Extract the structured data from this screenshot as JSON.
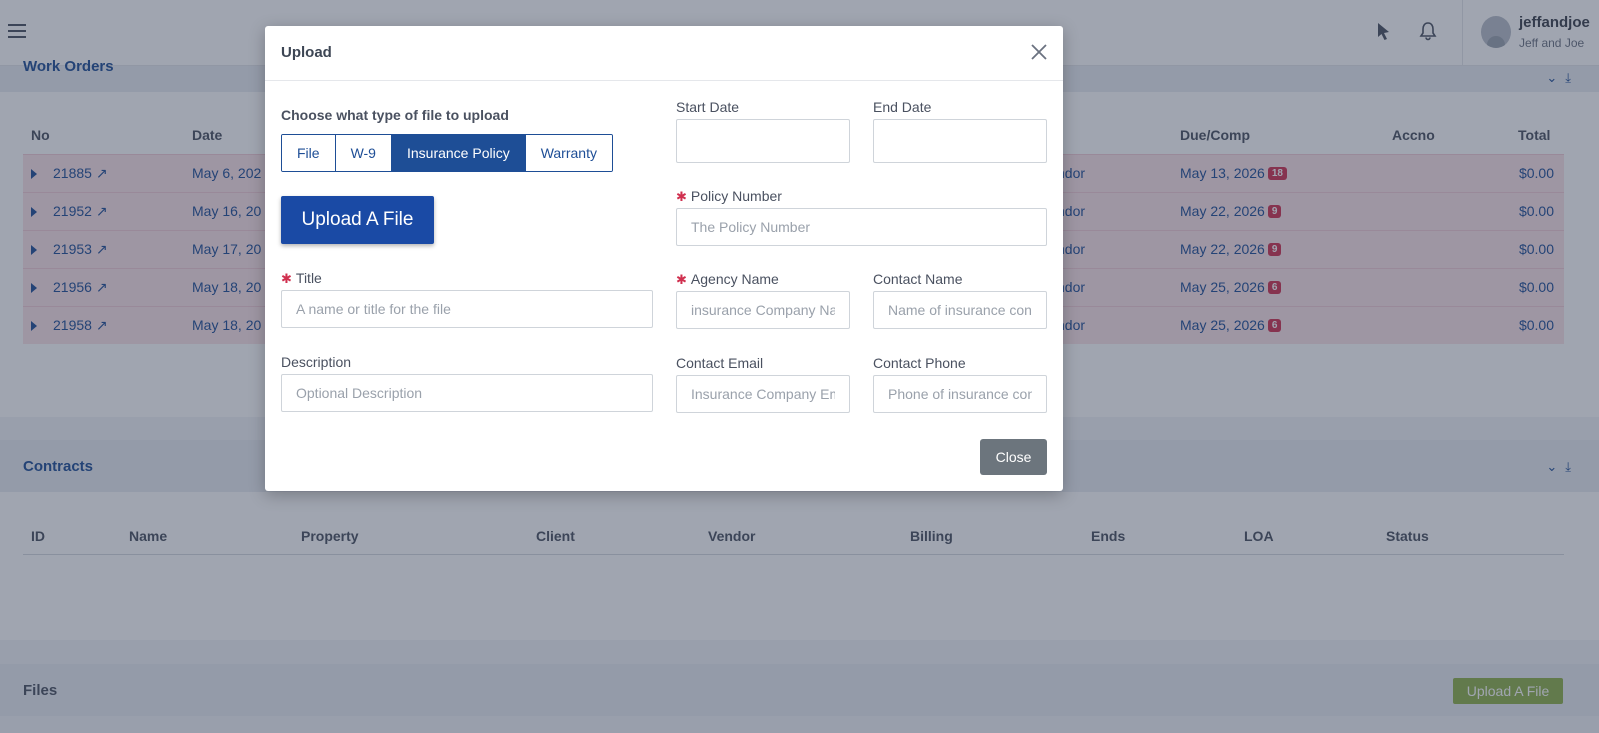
{
  "topbar": {
    "username": "jeffandjoe",
    "company": "Jeff and Joe"
  },
  "work_orders": {
    "title": "Work Orders",
    "columns": [
      "No",
      "Date",
      "Due/Comp",
      "Accno",
      "Total"
    ],
    "rows": [
      {
        "no": "21885",
        "date": "May 6, 202",
        "vendor": "ndor",
        "due": "May 13, 2026",
        "badge": "18",
        "total": "$0.00"
      },
      {
        "no": "21952",
        "date": "May 16, 20",
        "vendor": "ndor",
        "due": "May 22, 2026",
        "badge": "9",
        "total": "$0.00"
      },
      {
        "no": "21953",
        "date": "May 17, 20",
        "vendor": "ndor",
        "due": "May 22, 2026",
        "badge": "9",
        "total": "$0.00"
      },
      {
        "no": "21956",
        "date": "May 18, 20",
        "vendor": "ndor",
        "due": "May 25, 2026",
        "badge": "6",
        "total": "$0.00"
      },
      {
        "no": "21958",
        "date": "May 18, 20",
        "vendor": "ndor",
        "due": "May 25, 2026",
        "badge": "6",
        "total": "$0.00"
      }
    ]
  },
  "contracts": {
    "title": "Contracts",
    "columns": [
      "ID",
      "Name",
      "Property",
      "Client",
      "Vendor",
      "Billing",
      "Ends",
      "LOA",
      "Status"
    ]
  },
  "files": {
    "title": "Files",
    "upload_label": "Upload A File"
  },
  "modal": {
    "title": "Upload",
    "type_prompt": "Choose what type of file to upload",
    "types": [
      {
        "label": "File",
        "active": false
      },
      {
        "label": "W-9",
        "active": false
      },
      {
        "label": "Insurance Policy",
        "active": true
      },
      {
        "label": "Warranty",
        "active": false
      }
    ],
    "upload_button": "Upload A File",
    "title_label": "Title",
    "title_placeholder": "A name or title for the file",
    "description_label": "Description",
    "description_placeholder": "Optional Description",
    "start_date_label": "Start Date",
    "end_date_label": "End Date",
    "policy_number_label": "Policy Number",
    "policy_number_placeholder": "The Policy Number",
    "agency_name_label": "Agency Name",
    "agency_name_placeholder": "insurance Company Name",
    "contact_name_label": "Contact Name",
    "contact_name_placeholder": "Name of insurance contact",
    "contact_email_label": "Contact Email",
    "contact_email_placeholder": "Insurance Company Email",
    "contact_phone_label": "Contact Phone",
    "contact_phone_placeholder": "Phone of insurance contact",
    "close_button": "Close",
    "required_marker": "✱"
  },
  "colors": {
    "primary": "#1e4e96",
    "row_highlight": "#fbe3e8",
    "badge": "#d0304f",
    "files_button": "#8eb14a"
  }
}
